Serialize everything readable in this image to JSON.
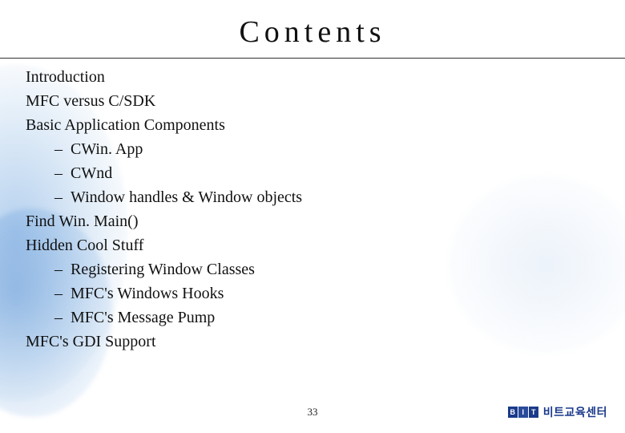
{
  "title": "Contents",
  "items": [
    {
      "text": "Introduction",
      "level": 0
    },
    {
      "text": "MFC versus C/SDK",
      "level": 0
    },
    {
      "text": "Basic Application Components",
      "level": 0
    },
    {
      "text": "CWin. App",
      "level": 1
    },
    {
      "text": "CWnd",
      "level": 1
    },
    {
      "text": "Window handles & Window objects",
      "level": 1
    },
    {
      "text": "Find Win. Main()",
      "level": 0
    },
    {
      "text": "Hidden Cool Stuff",
      "level": 0
    },
    {
      "text": "Registering Window Classes",
      "level": 1
    },
    {
      "text": "MFC's Windows Hooks",
      "level": 1
    },
    {
      "text": "MFC's Message Pump",
      "level": 1
    },
    {
      "text": "MFC's GDI Support",
      "level": 0
    }
  ],
  "page_number": "33",
  "logo": {
    "letters": [
      "B",
      "I",
      "T"
    ],
    "label": "비트교육센터"
  }
}
